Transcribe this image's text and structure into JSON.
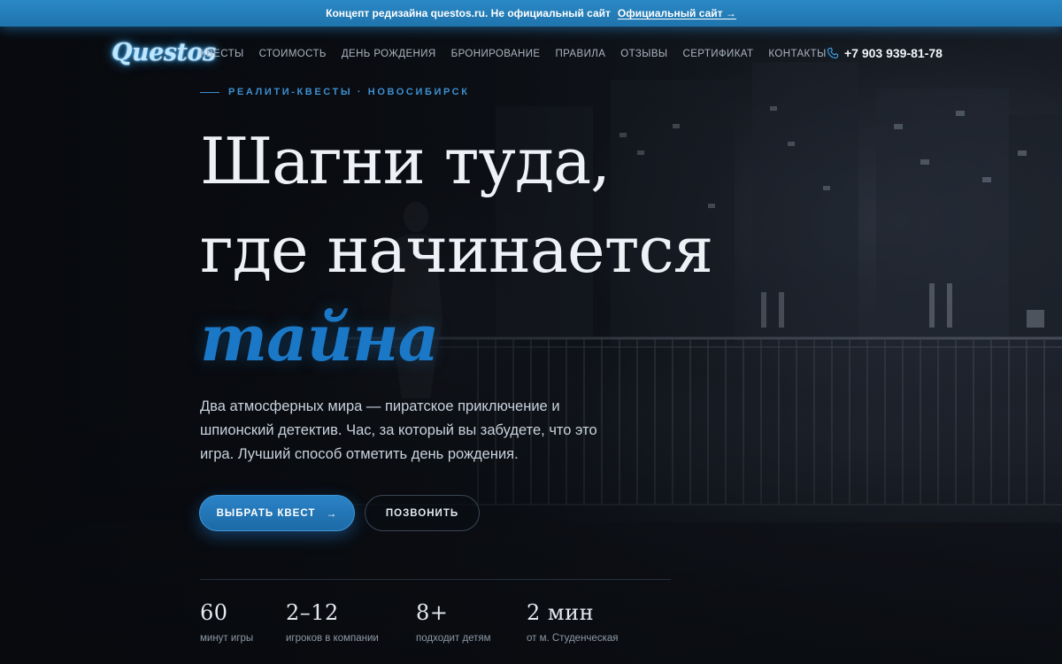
{
  "banner": {
    "text": "Концепт редизайна questos.ru. Не официальный сайт",
    "link_label": "Официальный сайт →"
  },
  "nav": {
    "logo": "Questos",
    "items": [
      "КВЕСТЫ",
      "СТОИМОСТЬ",
      "ДЕНЬ РОЖДЕНИЯ",
      "БРОНИРОВАНИЕ",
      "ПРАВИЛА",
      "ОТЗЫВЫ",
      "СЕРТИФИКАТ",
      "КОНТАКТЫ"
    ],
    "phone": "+7 903 939-81-78"
  },
  "hero": {
    "eyebrow": "РЕАЛИТИ-КВЕСТЫ · НОВОСИБИРСК",
    "headline_line1": "Шагни туда,",
    "headline_line2": "где начинается",
    "headline_accent": "тайна",
    "lead": "Два атмосферных мира — пиратское приключение и шпионский детектив. Час, за который вы забудете, что это игра. Лучший способ отметить день рождения.",
    "primary_cta": "ВЫБРАТЬ КВЕСТ",
    "primary_cta_arrow": "→",
    "secondary_cta": "ПОЗВОНИТЬ"
  },
  "stats": [
    {
      "value": "60",
      "label": "минут игры"
    },
    {
      "value": "2–12",
      "label": "игроков в компании"
    },
    {
      "value": "8+",
      "label": "подходит детям"
    },
    {
      "value": "2 мин",
      "label": "от м. Студенческая"
    }
  ],
  "colors": {
    "banner": "#2a88c4",
    "accent": "#1a78c6",
    "eyebrow": "#3d8fd0",
    "background": "#0b0e13"
  },
  "icons": {
    "phone": "phone-icon",
    "arrow": "arrow-right-icon"
  }
}
